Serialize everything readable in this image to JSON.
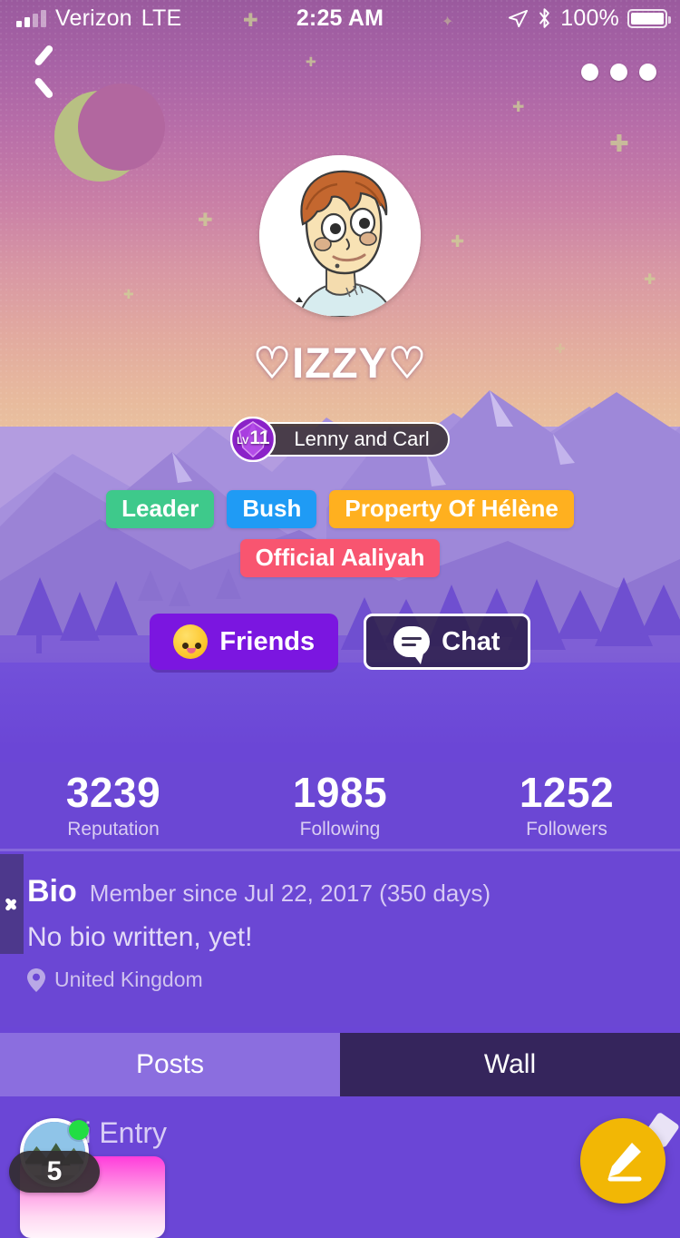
{
  "status_bar": {
    "carrier": "Verizon",
    "network": "LTE",
    "time": "2:25 AM",
    "battery_percent": "100%",
    "icons": [
      "signal-bars-icon",
      "location-arrow-icon",
      "bluetooth-icon",
      "battery-full-icon"
    ]
  },
  "nav": {
    "back_icon": "chevron-left-icon",
    "overflow_icon": "more-horizontal-icon"
  },
  "profile": {
    "avatar_icon": "user-avatar-cartoon",
    "username": "♡IZZY♡",
    "level": {
      "prefix": "LV",
      "value": "11",
      "title": "Lenny and Carl",
      "gem_color": "#8b22c8"
    },
    "tags": [
      {
        "label": "Leader",
        "color": "#3ec98b"
      },
      {
        "label": "Bush",
        "color": "#1f9bf5"
      },
      {
        "label": "Property Of Hélène",
        "color": "#ffb01f"
      },
      {
        "label": "Official Aaliyah",
        "color": "#f85570"
      }
    ],
    "actions": [
      {
        "label": "Friends",
        "icon": "smiley-face-icon",
        "style": "filled",
        "color": "#7b16e0"
      },
      {
        "label": "Chat",
        "icon": "chat-bubble-icon",
        "style": "outline",
        "color": "#281c42"
      }
    ]
  },
  "stats": [
    {
      "value": "3239",
      "label": "Reputation"
    },
    {
      "value": "1985",
      "label": "Following"
    },
    {
      "value": "1252",
      "label": "Followers"
    }
  ],
  "bio": {
    "title": "Bio",
    "member_since": "Member since Jul 22, 2017 (350 days)",
    "text": "No bio written, yet!",
    "location": "United Kingdom",
    "location_icon": "map-pin-icon",
    "drawer_icon": "chevron-right-icon"
  },
  "tabs": [
    {
      "label": "Posts",
      "active": true
    },
    {
      "label": "Wall",
      "active": false
    }
  ],
  "content": {
    "wiki_entry_label": "Wiki Entry",
    "floating_avatar_icon": "photo-avatar-icon",
    "online_status": "online",
    "unread_count": "5",
    "compose_icon": "pencil-icon",
    "compose_color": "#f2b705"
  }
}
